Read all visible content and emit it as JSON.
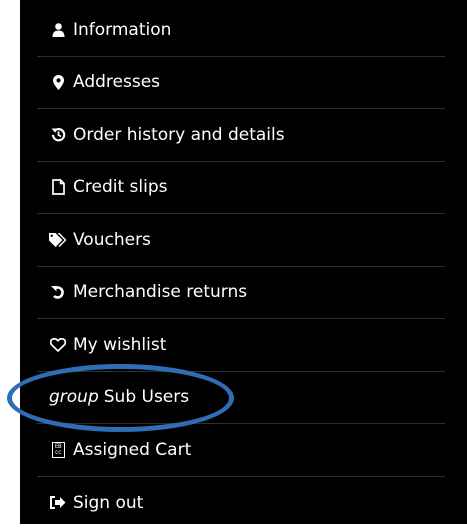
{
  "menu": {
    "items": [
      {
        "label": "Information",
        "icon": "user-icon"
      },
      {
        "label": "Addresses",
        "icon": "map-marker-icon"
      },
      {
        "label": "Order history and details",
        "icon": "history-icon"
      },
      {
        "label": "Credit slips",
        "icon": "file-icon"
      },
      {
        "label": "Vouchers",
        "icon": "tags-icon"
      },
      {
        "label": "Merchandise returns",
        "icon": "undo-icon"
      },
      {
        "label": "My wishlist",
        "icon": "heart-outline-icon"
      },
      {
        "group_word": "group",
        "label": "Sub Users",
        "icon": "none"
      },
      {
        "label": "Assigned Cart",
        "icon": "closed-caption-box-icon",
        "icon_text_top": "EB",
        "icon_text_bottom": "cc"
      },
      {
        "label": "Sign out",
        "icon": "sign-out-icon"
      }
    ]
  },
  "colors": {
    "panel_background": "#000000",
    "text": "#ffffff",
    "divider": "#2f2f2f",
    "highlight_ellipse": "#2f6db4"
  }
}
